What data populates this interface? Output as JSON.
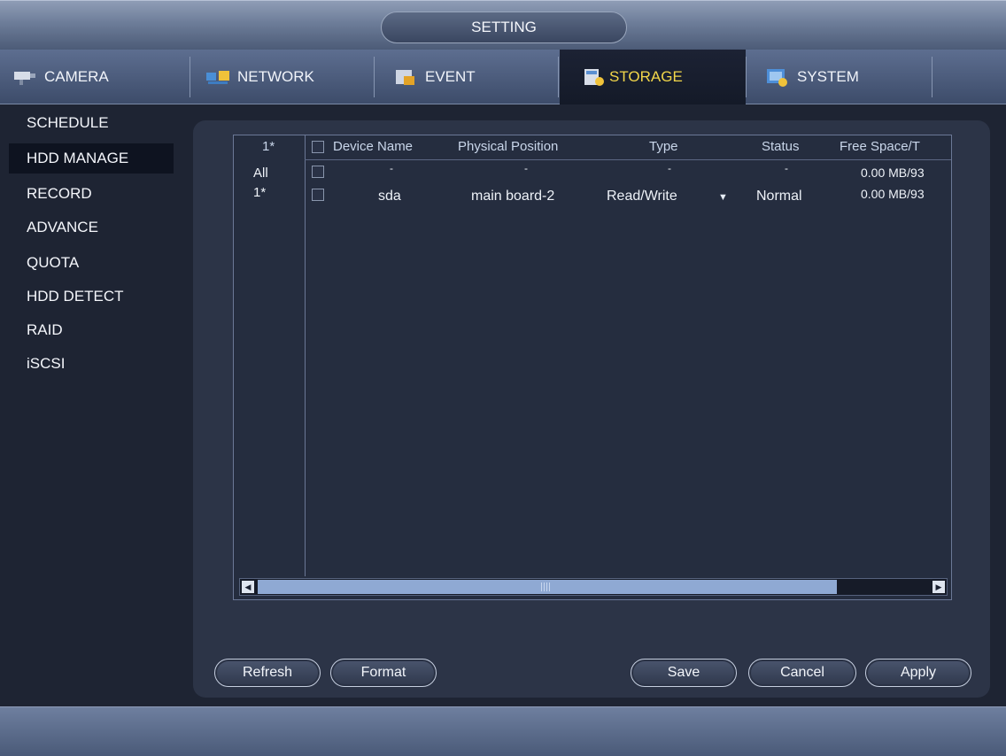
{
  "window": {
    "title": "SETTING"
  },
  "tabs": [
    {
      "label": "CAMERA",
      "icon": "camera-icon",
      "active": false
    },
    {
      "label": "NETWORK",
      "icon": "network-icon",
      "active": false
    },
    {
      "label": "EVENT",
      "icon": "event-icon",
      "active": false
    },
    {
      "label": "STORAGE",
      "icon": "storage-icon",
      "active": true
    },
    {
      "label": "SYSTEM",
      "icon": "system-icon",
      "active": false
    }
  ],
  "sidebar": {
    "items": [
      {
        "label": "SCHEDULE"
      },
      {
        "label": "HDD MANAGE",
        "active": true
      },
      {
        "label": "RECORD"
      },
      {
        "label": "ADVANCE"
      },
      {
        "label": "QUOTA"
      },
      {
        "label": "HDD DETECT"
      },
      {
        "label": "RAID"
      },
      {
        "label": "iSCSI"
      }
    ]
  },
  "table": {
    "columns": [
      "1*",
      "Device Name",
      "Physical Position",
      "Type",
      "Status",
      "Free Space/T"
    ],
    "rows": [
      {
        "id": "All",
        "device": "-",
        "position": "-",
        "type": "-",
        "status": "-",
        "free": "0.00 MB/93"
      },
      {
        "id": "1*",
        "device": "sda",
        "position": "main board-2",
        "type": "Read/Write",
        "status": "Normal",
        "free": "0.00 MB/93"
      }
    ]
  },
  "buttons": {
    "refresh": "Refresh",
    "format": "Format",
    "save": "Save",
    "cancel": "Cancel",
    "apply": "Apply"
  },
  "colors": {
    "active_tab_text": "#f2d64a",
    "background": "#1e2433",
    "scroll_thumb": "#8fa9d3"
  }
}
